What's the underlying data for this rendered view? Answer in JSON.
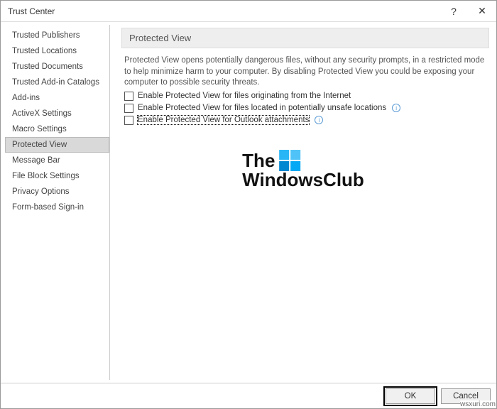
{
  "window": {
    "title": "Trust Center",
    "help_label": "?",
    "close_label": "✕"
  },
  "sidebar": {
    "items": [
      {
        "label": "Trusted Publishers"
      },
      {
        "label": "Trusted Locations"
      },
      {
        "label": "Trusted Documents"
      },
      {
        "label": "Trusted Add-in Catalogs"
      },
      {
        "label": "Add-ins"
      },
      {
        "label": "ActiveX Settings"
      },
      {
        "label": "Macro Settings"
      },
      {
        "label": "Protected View",
        "selected": true
      },
      {
        "label": "Message Bar"
      },
      {
        "label": "File Block Settings"
      },
      {
        "label": "Privacy Options"
      },
      {
        "label": "Form-based Sign-in"
      }
    ]
  },
  "panel": {
    "header": "Protected View",
    "description": "Protected View opens potentially dangerous files, without any security prompts, in a restricted mode to help minimize harm to your computer. By disabling Protected View you could be exposing your computer to possible security threats.",
    "checks": [
      {
        "label": "Enable Protected View for files originating from the Internet",
        "checked": false,
        "info": false
      },
      {
        "label": "Enable Protected View for files located in potentially unsafe locations",
        "checked": false,
        "info": true
      },
      {
        "label": "Enable Protected View for Outlook attachments",
        "checked": false,
        "info": true,
        "focused": true
      }
    ]
  },
  "watermark": {
    "line1": "The",
    "line2": "WindowsClub"
  },
  "buttons": {
    "ok": "OK",
    "cancel": "Cancel"
  },
  "corner": "wsxuri.com"
}
